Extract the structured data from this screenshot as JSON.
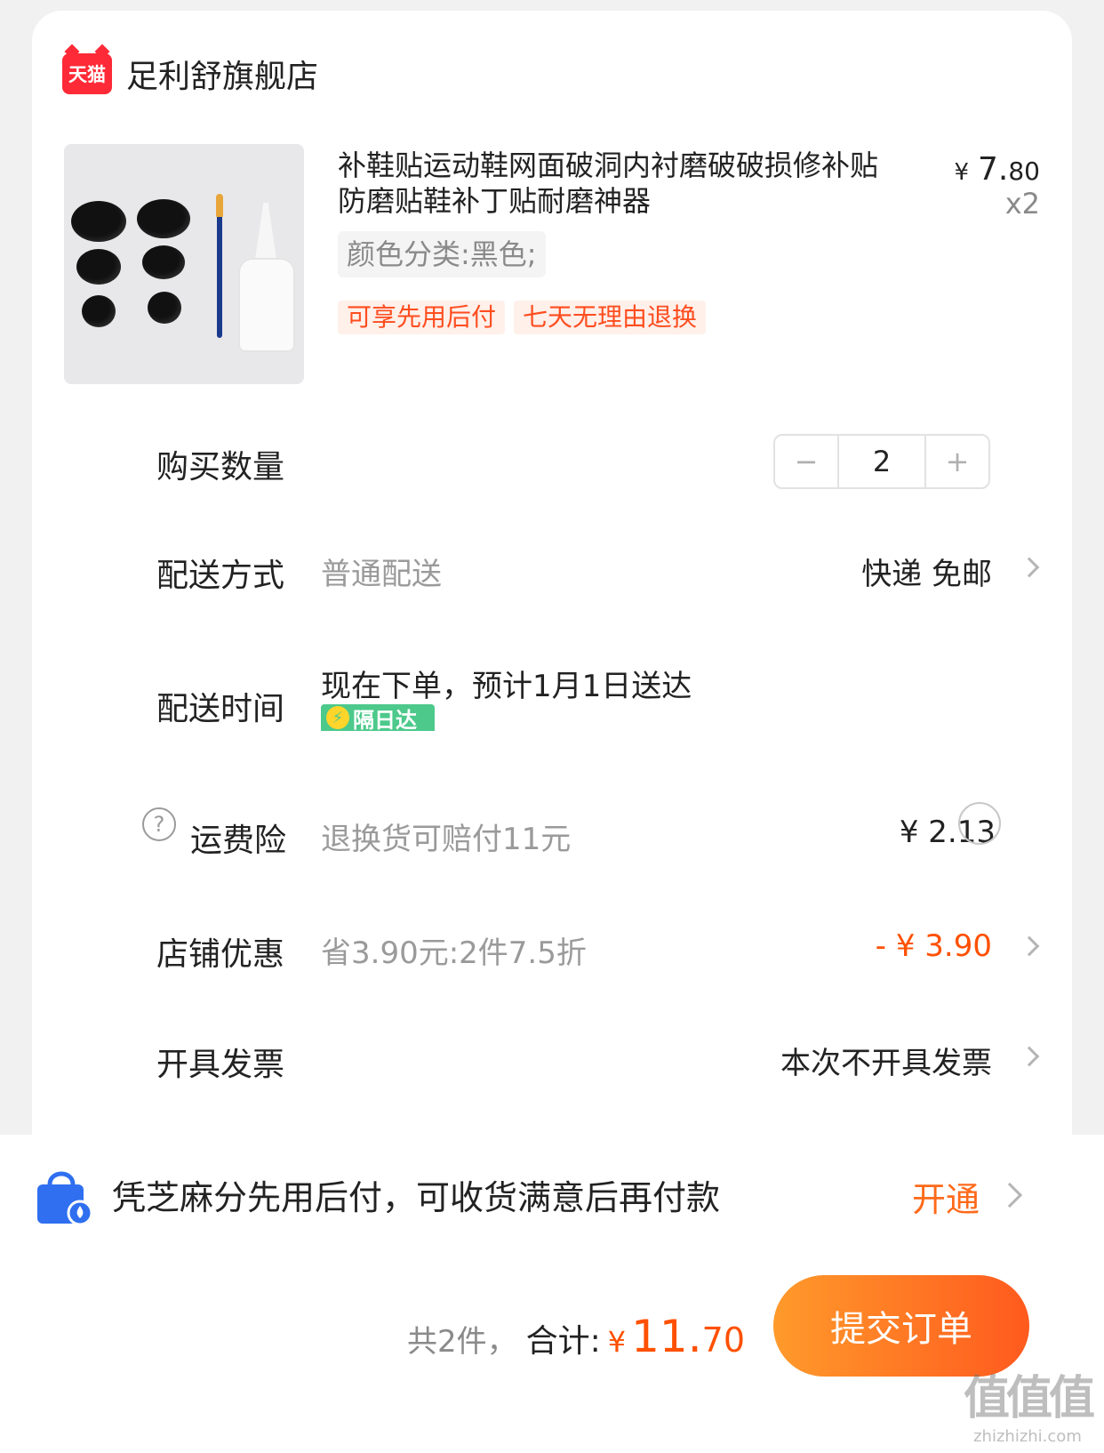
{
  "store": {
    "logo_text": "天猫",
    "name": "足利舒旗舰店"
  },
  "product": {
    "title": "补鞋贴运动鞋网面破洞内衬磨破破损修补贴防磨贴鞋补丁贴耐磨神器",
    "price_symbol": "¥",
    "price_int": "7.",
    "price_dec": "80",
    "quantity_mult": "x2",
    "sku": "颜色分类:黑色;",
    "tags": [
      "可享先用后付",
      "七天无理由退换"
    ]
  },
  "quantity": {
    "label": "购买数量",
    "minus": "−",
    "value": "2",
    "plus": "+"
  },
  "delivery_method": {
    "label": "配送方式",
    "value": "普通配送",
    "right": "快递 免邮"
  },
  "delivery_time": {
    "label": "配送时间",
    "value": "现在下单，预计1月1日送达",
    "badge": "隔日达"
  },
  "shipping_insurance": {
    "label": "运费险",
    "help": "?",
    "desc": "退换货可赔付11元",
    "price": "¥ 2.13"
  },
  "store_discount": {
    "label": "店铺优惠",
    "desc": "省3.90元:2件7.5折",
    "amount": "- ¥ 3.90",
    "amount_color": "#ff5000"
  },
  "invoice": {
    "label": "开具发票",
    "value": "本次不开具发票"
  },
  "zhima": {
    "text": "凭芝麻分先用后付，可收货满意后再付款",
    "action": "开通",
    "icon": "shopping-bag-icon"
  },
  "footer": {
    "count_text": "共2件，",
    "total_label": "合计:",
    "currency": "¥",
    "total_int": "11.",
    "total_dec": "70",
    "submit": "提交订单"
  },
  "watermark": {
    "big": "值值值",
    "small": "zhizhizhi.com"
  },
  "colors": {
    "accent": "#ff5000",
    "tag_bg": "#fff0ea",
    "badge_green": "#4cc98b",
    "tmall_red": "#ff2a37"
  }
}
